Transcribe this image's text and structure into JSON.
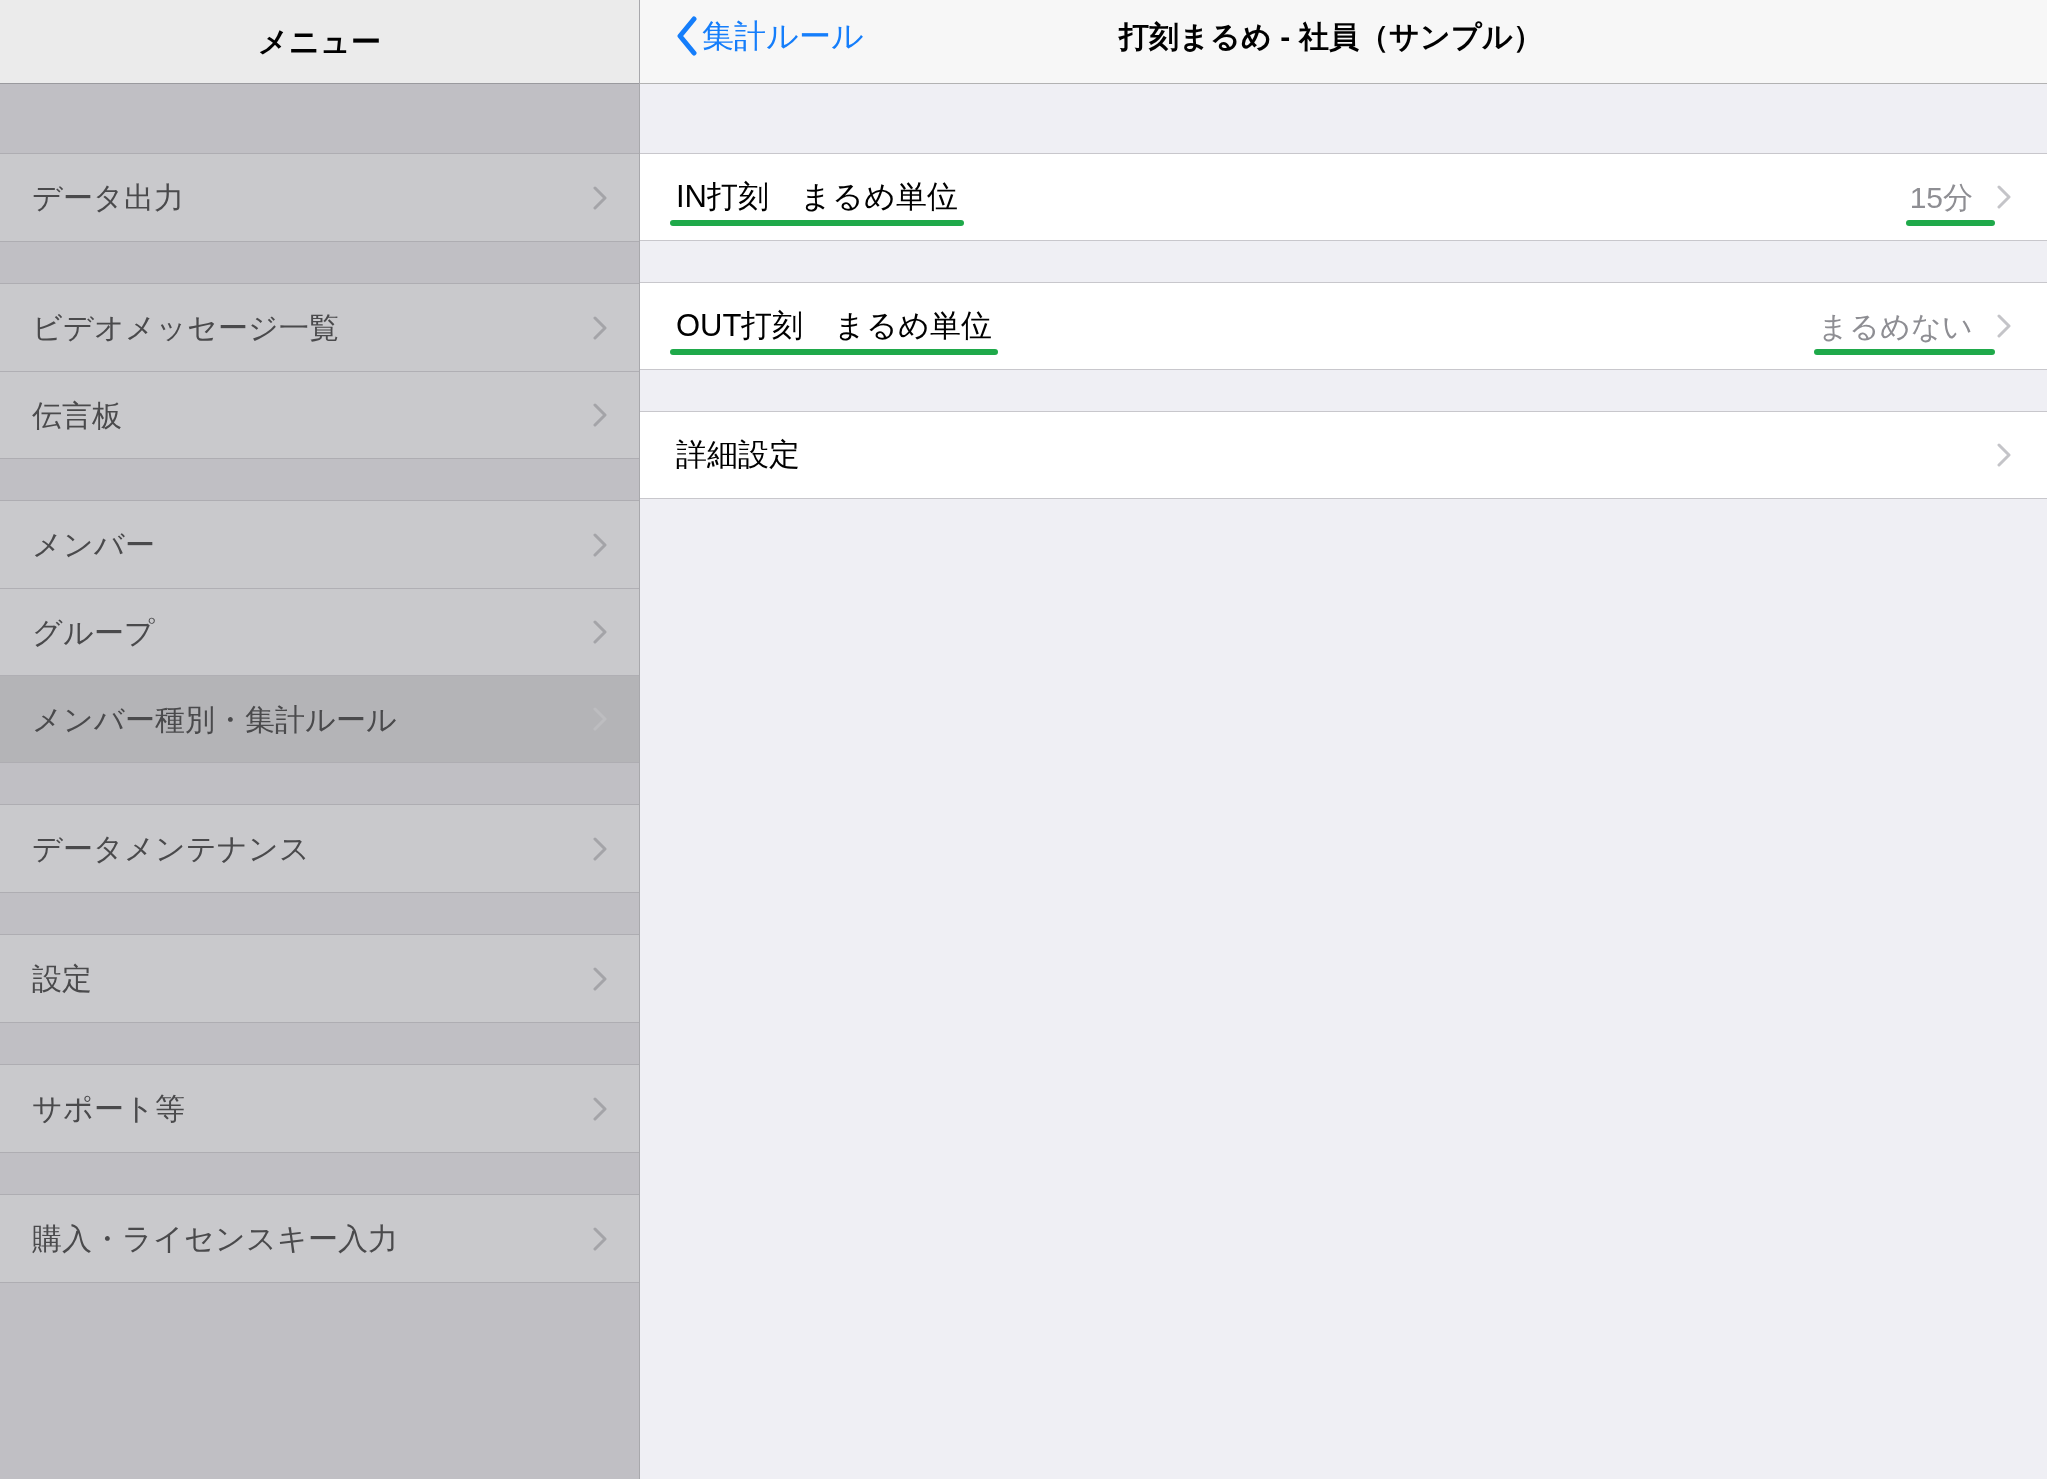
{
  "sidebar": {
    "title": "メニュー",
    "groups": [
      {
        "items": [
          {
            "label": "データ出力",
            "selected": false
          }
        ]
      },
      {
        "items": [
          {
            "label": "ビデオメッセージ一覧",
            "selected": false
          },
          {
            "label": "伝言板",
            "selected": false
          }
        ]
      },
      {
        "items": [
          {
            "label": "メンバー",
            "selected": false
          },
          {
            "label": "グループ",
            "selected": false
          },
          {
            "label": "メンバー種別・集計ルール",
            "selected": true
          }
        ]
      },
      {
        "items": [
          {
            "label": "データメンテナンス",
            "selected": false
          }
        ]
      },
      {
        "items": [
          {
            "label": "設定",
            "selected": false
          }
        ]
      },
      {
        "items": [
          {
            "label": "サポート等",
            "selected": false
          }
        ]
      },
      {
        "items": [
          {
            "label": "購入・ライセンスキー入力",
            "selected": false
          }
        ]
      }
    ]
  },
  "detail": {
    "back": "集計ルール",
    "title": "打刻まるめ - 社員（サンプル）",
    "groups": [
      {
        "rows": [
          {
            "label": "IN打刻　まるめ単位",
            "value": "15分",
            "underlined": true
          }
        ]
      },
      {
        "rows": [
          {
            "label": "OUT打刻　まるめ単位",
            "value": "まるめない",
            "underlined": true
          }
        ]
      },
      {
        "rows": [
          {
            "label": "詳細設定",
            "underlined": false
          }
        ]
      }
    ]
  }
}
